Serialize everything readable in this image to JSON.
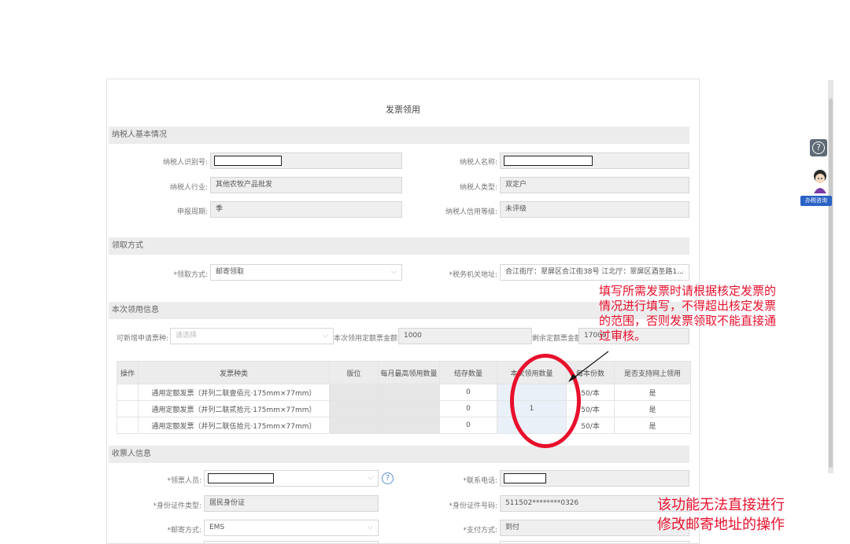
{
  "page_title": "发票领用",
  "sections": {
    "basic": "纳税人基本情况",
    "pickup": "领取方式",
    "request": "本次领用信息",
    "recipient": "收票人信息"
  },
  "basic": {
    "taxpayer_id_label": "纳税人识别号:",
    "taxpayer_name_label": "纳税人名称:",
    "industry_label": "纳税人行业:",
    "industry_value": "其他农牧产品批发",
    "type_label": "纳税人类型:",
    "type_value": "双定户",
    "period_label": "申报周期:",
    "period_value": "季",
    "credit_label": "纳税人信用等级:",
    "credit_value": "未评级"
  },
  "pickup": {
    "method_label": "*领取方式:",
    "method_value": "邮寄领取",
    "office_label": "*税务机关地址:",
    "office_value": "合江街厅：翠屏区合江街38号 江北厅：翠屏区酒圣路1..."
  },
  "request": {
    "apply_type_label": "可新增申请票种:",
    "apply_type_placeholder": "请选择",
    "total_label": "本次领用定额票金额:",
    "total_value": "1000",
    "remaining_label": "剩余定额票金额:",
    "remaining_value": "17000"
  },
  "table": {
    "headers": [
      "操作",
      "发票种类",
      "版位",
      "每月最高领用数量",
      "结存数量",
      "本次领用数量",
      "每本份数",
      "是否支持网上领用"
    ],
    "rows": [
      {
        "type": "通用定额发票（并列二联壹佰元·175mm×77mm）",
        "stock": "0",
        "qty": "",
        "per_book": "50/本",
        "online": "是"
      },
      {
        "type": "通用定额发票（并列二联贰拾元·175mm×77mm）",
        "stock": "0",
        "qty": "1",
        "per_book": "50/本",
        "online": "是"
      },
      {
        "type": "通用定额发票（并列二联伍拾元·175mm×77mm）",
        "stock": "0",
        "qty": "",
        "per_book": "50/本",
        "online": "是"
      }
    ]
  },
  "recipient": {
    "person_label": "*领票人员:",
    "phone_label": "*联系电话:",
    "id_type_label": "*身份证件类型:",
    "id_type_value": "居民身份证",
    "id_no_label": "*身份证件号码:",
    "id_no_value": "511502********0326",
    "mail_label": "*邮寄方式:",
    "mail_value": "EMS",
    "pay_label": "*支付方式:",
    "pay_value": "到付"
  },
  "annotations": {
    "note1_lines": [
      "填写所需发票时请根据核定发票的",
      "情况进行填写，不得超出核定发票",
      "的范围，否则发票领取不能直接通",
      "过审核。"
    ],
    "note2_lines": [
      "该功能无法直接进行",
      "修改邮寄地址的操作"
    ],
    "color": "#e8102c"
  },
  "side": {
    "consult_label": "办税咨询"
  }
}
